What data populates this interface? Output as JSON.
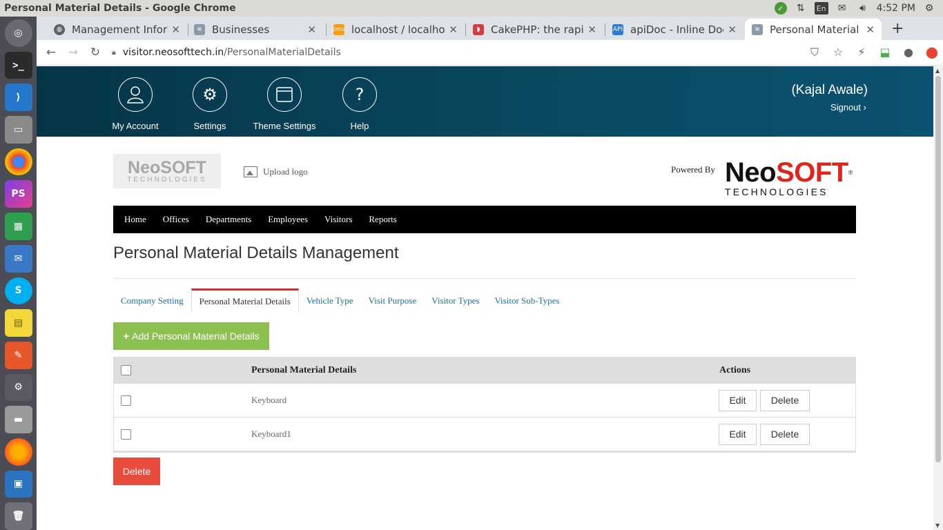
{
  "os": {
    "window_title": "Personal Material Details - Google Chrome",
    "tray": {
      "keyboard_layout": "En",
      "clock": "4:52 PM"
    }
  },
  "browser": {
    "tabs": [
      {
        "label": "Management Inform",
        "favicon": "globe-icon",
        "active": false
      },
      {
        "label": "Businesses",
        "favicon": "stack-icon",
        "active": false
      },
      {
        "label": "localhost / localhost",
        "favicon": "phpmyadmin-icon",
        "active": false
      },
      {
        "label": "CakePHP: the rapid d",
        "favicon": "cakephp-icon",
        "active": false
      },
      {
        "label": "apiDoc - Inline Docu",
        "favicon": "apidoc-icon",
        "active": false
      },
      {
        "label": "Personal Material De",
        "favicon": "stack-icon",
        "active": true
      }
    ],
    "url_host": "visitor.neosofttech.in",
    "url_path": "/PersonalMaterialDetails"
  },
  "header": {
    "items": [
      {
        "label": "My Account",
        "icon": "user-icon"
      },
      {
        "label": "Settings",
        "icon": "gear-icon"
      },
      {
        "label": "Theme Settings",
        "icon": "window-icon"
      },
      {
        "label": "Help",
        "icon": "question-icon"
      }
    ],
    "username": "(Kajal  Awale)",
    "signout": "Signout"
  },
  "branding": {
    "logo_line1": "NeoSOFT",
    "logo_line2": "TECHNOLOGIES",
    "upload_logo": "Upload logo",
    "powered_by": "Powered By",
    "brand_neo": "Neo",
    "brand_soft": "SOFT",
    "brand_reg": "®",
    "brand_sub": "TECHNOLOGIES"
  },
  "nav": {
    "items": [
      "Home",
      "Offices",
      "Departments",
      "Employees",
      "Visitors",
      "Reports"
    ]
  },
  "page_title": "Personal Material Details Management",
  "subtabs": {
    "items": [
      "Company Setting",
      "Personal Material Details",
      "Vehicle Type",
      "Visit Purpose",
      "Visitor Types",
      "Visitor Sub-Types"
    ],
    "active_index": 1
  },
  "add_button": "Add Personal Material Details",
  "table": {
    "headers": {
      "name": "Personal Material Details",
      "actions": "Actions"
    },
    "rows": [
      {
        "name": "Keyboard"
      },
      {
        "name": "Keyboard1"
      }
    ],
    "edit_label": "Edit",
    "delete_label": "Delete"
  },
  "bulk_delete": "Delete",
  "colors": {
    "header_bg": "#063548",
    "add_button": "#8cc152",
    "delete_button": "#e74c3c",
    "active_tab_border": "#c9302c",
    "brand_red": "#e2231a"
  }
}
